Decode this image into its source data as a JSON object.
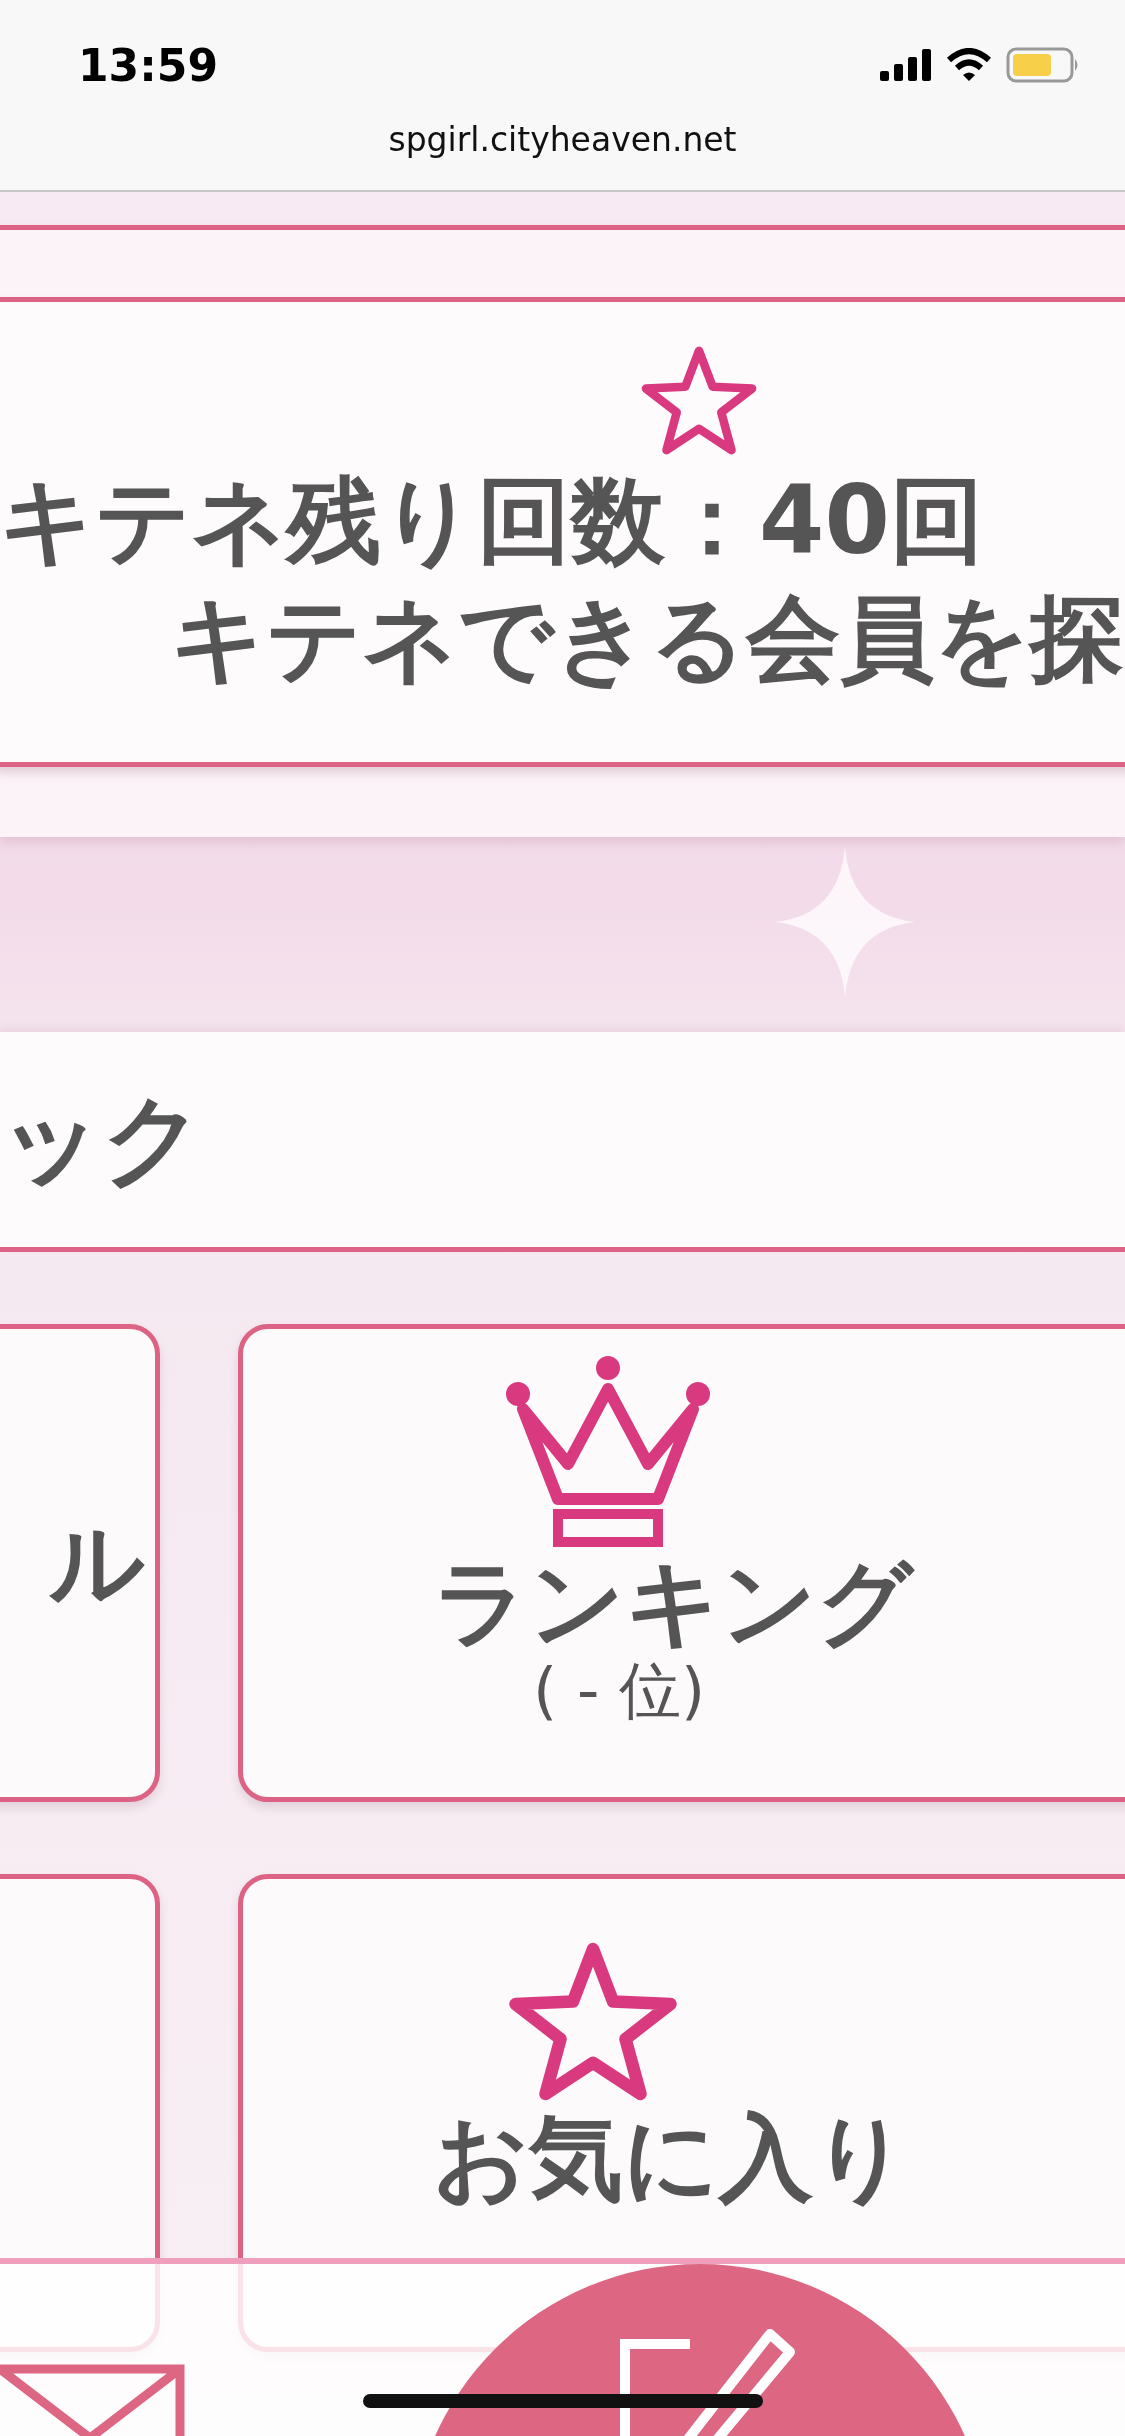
{
  "status_bar": {
    "time": "13:59"
  },
  "address_bar": {
    "url": "spgirl.cityheaven.net"
  },
  "kitene_card": {
    "remaining": "キテネ残り回数：40回",
    "action": "キテネできる会員を探"
  },
  "section": {
    "title": "ック"
  },
  "tiles": [
    {
      "kind": "text",
      "label": "ル"
    },
    {
      "kind": "icon",
      "label": "ランキング",
      "sub": "( - 位)"
    },
    {
      "kind": "empty"
    },
    {
      "kind": "icon",
      "label": "お気に入り"
    }
  ]
}
